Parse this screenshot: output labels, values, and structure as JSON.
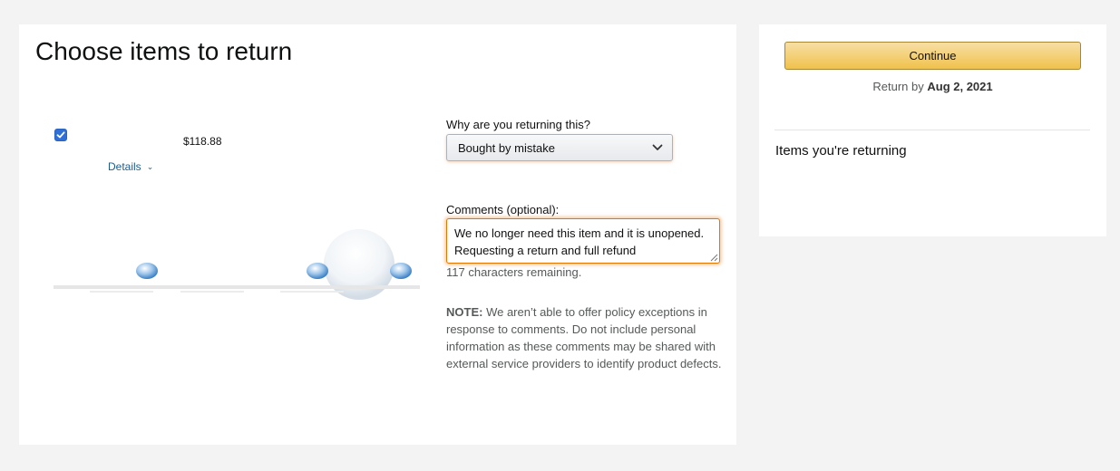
{
  "main": {
    "title": "Choose items to return",
    "item": {
      "checked": true,
      "price": "$118.88",
      "details_label": "Details"
    },
    "reason": {
      "label": "Why are you returning this?",
      "selected": "Bought by mistake"
    },
    "comments": {
      "label": "Comments (optional):",
      "value": "We no longer need this item and it is unopened. Requesting a return and full refund",
      "remaining": "117 characters remaining."
    },
    "note": {
      "prefix": "NOTE:",
      "text": " We aren’t able to offer policy exceptions in response to comments. Do not include personal information as these comments may be shared with external service providers to identify product defects."
    }
  },
  "side": {
    "continue_label": "Continue",
    "return_by_prefix": "Return by ",
    "return_by_date": "Aug 2, 2021",
    "items_returning_label": "Items you're returning"
  },
  "colors": {
    "accent": "#e77600",
    "button": "#f0c14b",
    "checkbox": "#2f6fd6",
    "link": "#1f5c8c"
  }
}
